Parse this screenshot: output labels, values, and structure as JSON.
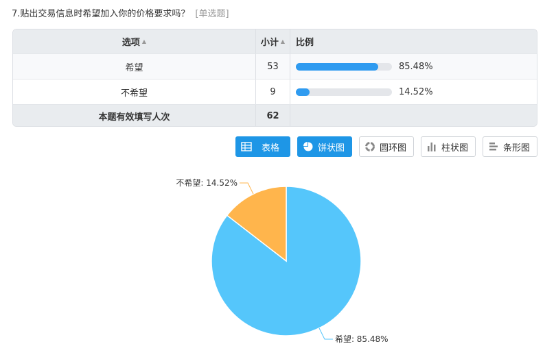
{
  "question": {
    "title": "7.贴出交易信息时希望加入你的价格要求吗？",
    "type": "[单选题]"
  },
  "table": {
    "headers": {
      "option": "选项",
      "count": "小计",
      "ratio": "比例",
      "sort_icon": "sort-icon"
    },
    "rows": [
      {
        "option": "希望",
        "count": "53",
        "percent_text": "85.48%",
        "percent": 85.48
      },
      {
        "option": "不希望",
        "count": "9",
        "percent_text": "14.52%",
        "percent": 14.52
      }
    ],
    "total": {
      "label": "本题有效填写人次",
      "count": "62"
    },
    "bar_color": "#2f9bf0",
    "track_color": "#e4e6ea"
  },
  "view_buttons": [
    {
      "label": "表格",
      "icon": "table-icon",
      "active": true
    },
    {
      "label": "饼状图",
      "icon": "pie-chart-icon",
      "active": true
    },
    {
      "label": "圆环图",
      "icon": "donut-chart-icon",
      "active": false
    },
    {
      "label": "柱状图",
      "icon": "bar-chart-icon",
      "active": false
    },
    {
      "label": "条形图",
      "icon": "horizontal-bar-chart-icon",
      "active": false
    }
  ],
  "chart_data": {
    "type": "pie",
    "categories": [
      "希望",
      "不希望"
    ],
    "values": [
      85.48,
      14.52
    ],
    "labels": [
      "希望: 85.48%",
      "不希望: 14.52%"
    ],
    "colors": [
      "#55c6fb",
      "#ffb54c"
    ],
    "title": ""
  }
}
